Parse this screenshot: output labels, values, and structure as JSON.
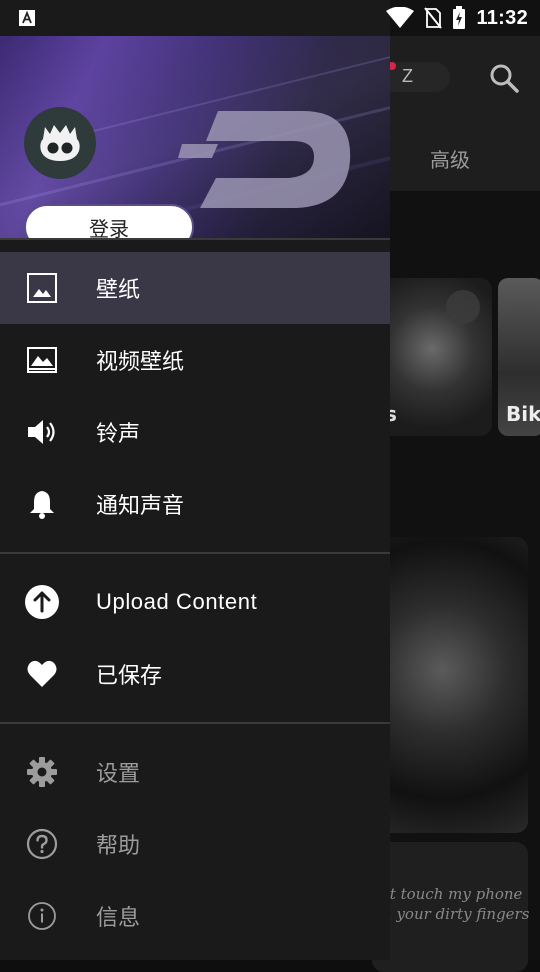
{
  "status_bar": {
    "time": "11:32",
    "icons": [
      "app-a-icon",
      "wifi-icon",
      "no-sim-icon",
      "battery-charging-icon"
    ]
  },
  "background": {
    "pill_text": "Z",
    "tab_label": "高级",
    "card1_text": "s",
    "card2_text": "Bik",
    "card4_text_line1": "n't touch my phone",
    "card4_text_line2": "th your dirty fingers"
  },
  "drawer": {
    "login_label": "登录",
    "brand_accent": "#5c4c88",
    "menu": [
      {
        "label": "壁纸",
        "icon": "image-icon",
        "selected": true
      },
      {
        "label": "视频壁纸",
        "icon": "video-wallpaper-icon"
      },
      {
        "label": "铃声",
        "icon": "speaker-icon"
      },
      {
        "label": "通知声音",
        "icon": "bell-icon"
      }
    ],
    "secondary": [
      {
        "label": "Upload Content",
        "icon": "upload-icon"
      },
      {
        "label": "已保存",
        "icon": "heart-icon"
      }
    ],
    "footer": [
      {
        "label": "设置",
        "icon": "gear-icon"
      },
      {
        "label": "帮助",
        "icon": "help-icon"
      },
      {
        "label": "信息",
        "icon": "info-icon"
      }
    ]
  }
}
